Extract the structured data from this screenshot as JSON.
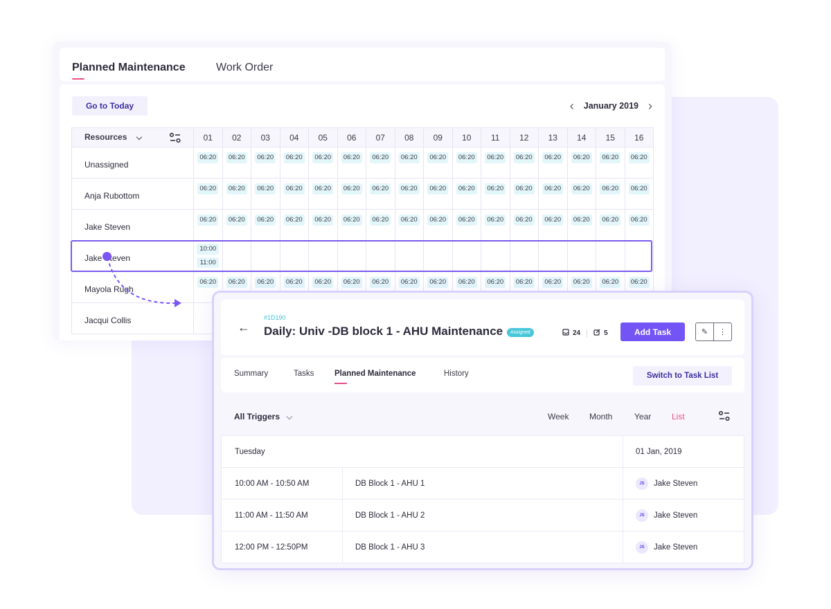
{
  "scheduler": {
    "tabs": [
      {
        "label": "Planned Maintenance",
        "active": true
      },
      {
        "label": "Work Order",
        "active": false
      }
    ],
    "go_today_label": "Go to Today",
    "month_label": "January 2019",
    "prev_icon": "chevron-left-icon",
    "next_icon": "chevron-right-icon",
    "resources_label": "Resources",
    "days": [
      "01",
      "02",
      "03",
      "04",
      "05",
      "06",
      "07",
      "08",
      "09",
      "10",
      "11",
      "12",
      "13",
      "14",
      "15",
      "16"
    ],
    "rows": [
      {
        "name": "Unassigned",
        "slots": "06:20",
        "slot_count": 16
      },
      {
        "name": "Anja Rubottom",
        "slots": "06:20",
        "slot_count": 16
      },
      {
        "name": "Jake Steven",
        "slots": "06:20",
        "slot_count": 16
      },
      {
        "name": "Jake Steven",
        "day01_slots": [
          "10:00",
          "11:00"
        ],
        "highlighted": true
      },
      {
        "name": "Mayola Rugh",
        "slots": "06:20",
        "slot_count": 16
      },
      {
        "name": "Jacqui Collis"
      }
    ],
    "accent_color": "#7a5af0",
    "underline_color": "#ea4c89"
  },
  "detail": {
    "ticket_id": "#1D190",
    "title": "Daily: Univ -DB block 1 - AHU Maintenance",
    "status_badge": "Assigned",
    "comment_count": "24",
    "edit_count": "5",
    "add_task_label": "Add Task",
    "tabs": [
      {
        "label": "Summary",
        "active": false
      },
      {
        "label": "Tasks",
        "active": false
      },
      {
        "label": "Planned Maintenance",
        "active": true
      },
      {
        "label": "History",
        "active": false
      }
    ],
    "switch_label": "Switch to Task List",
    "trigger_filter": "All Triggers",
    "views": [
      {
        "label": "Week",
        "active": false
      },
      {
        "label": "Month",
        "active": false
      },
      {
        "label": "Year",
        "active": false
      },
      {
        "label": "List",
        "active": true
      }
    ],
    "day_label": "Tuesday",
    "date_label": "01 Jan, 2019",
    "entries": [
      {
        "time": "10:00 AM - 10:50 AM",
        "task": "DB Block 1 - AHU 1",
        "initials": "JS",
        "assignee": "Jake Steven"
      },
      {
        "time": "11:00 AM - 11:50 AM",
        "task": "DB Block 1 - AHU 2",
        "initials": "JS",
        "assignee": "Jake Steven"
      },
      {
        "time": "12:00 PM - 12:50PM",
        "task": "DB Block 1 - AHU 3",
        "initials": "JS",
        "assignee": "Jake Steven"
      }
    ],
    "primary_color": "#7354f5",
    "badge_color": "#49c7da"
  }
}
